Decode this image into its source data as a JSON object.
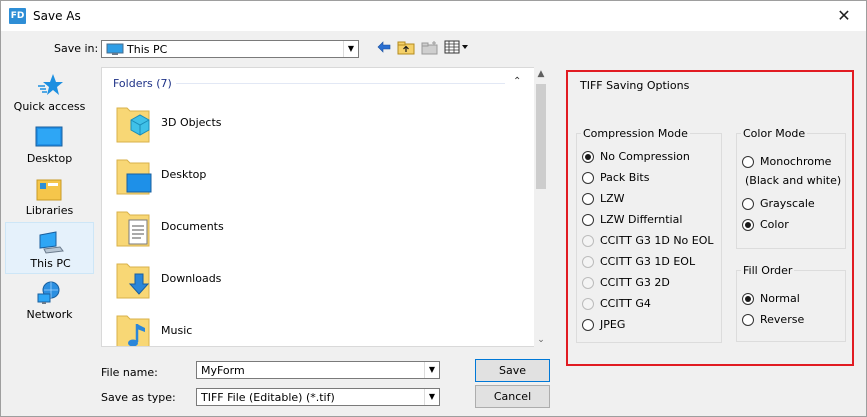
{
  "window": {
    "app_icon": "FD",
    "title": "Save As",
    "close_glyph": "✕"
  },
  "save_in": {
    "label": "Save in:",
    "value": "This PC"
  },
  "toolbar_icons": [
    "back-arrow-icon",
    "up-folder-icon",
    "new-folder-icon",
    "view-menu-icon"
  ],
  "places": [
    {
      "label": "Quick access",
      "icon": "star-icon"
    },
    {
      "label": "Desktop",
      "icon": "desktop-icon"
    },
    {
      "label": "Libraries",
      "icon": "libraries-icon"
    },
    {
      "label": "This PC",
      "icon": "computer-icon",
      "selected": true
    },
    {
      "label": "Network",
      "icon": "network-icon"
    }
  ],
  "file_list": {
    "group_header": "Folders (7)",
    "items": [
      {
        "name": "3D Objects",
        "icon": "3d-objects-folder-icon"
      },
      {
        "name": "Desktop",
        "icon": "desktop-folder-icon"
      },
      {
        "name": "Documents",
        "icon": "documents-folder-icon"
      },
      {
        "name": "Downloads",
        "icon": "downloads-folder-icon"
      },
      {
        "name": "Music",
        "icon": "music-folder-icon"
      }
    ]
  },
  "file_name": {
    "label": "File name:",
    "value": "MyForm"
  },
  "save_as_type": {
    "label": "Save as type:",
    "value": "TIFF File (Editable) (*.tif)"
  },
  "buttons": {
    "save": "Save",
    "cancel": "Cancel"
  },
  "tiff_options": {
    "title": "TIFF Saving Options",
    "compression": {
      "title": "Compression Mode",
      "options": [
        {
          "label": "No Compression",
          "checked": true,
          "enabled": true
        },
        {
          "label": "Pack Bits",
          "checked": false,
          "enabled": true
        },
        {
          "label": "LZW",
          "checked": false,
          "enabled": true
        },
        {
          "label": "LZW Differntial",
          "checked": false,
          "enabled": true
        },
        {
          "label": "CCITT G3 1D No EOL",
          "checked": false,
          "enabled": false
        },
        {
          "label": "CCITT G3 1D EOL",
          "checked": false,
          "enabled": false
        },
        {
          "label": "CCITT G3 2D",
          "checked": false,
          "enabled": false
        },
        {
          "label": "CCITT G4",
          "checked": false,
          "enabled": false
        },
        {
          "label": "JPEG",
          "checked": false,
          "enabled": true
        }
      ]
    },
    "color_mode": {
      "title": "Color Mode",
      "monochrome": "Monochrome",
      "monochrome_sub": "(Black and white)",
      "grayscale": "Grayscale",
      "color": "Color",
      "selected": "Color"
    },
    "fill_order": {
      "title": "Fill Order",
      "normal": "Normal",
      "reverse": "Reverse",
      "selected": "Normal"
    }
  },
  "colors": {
    "accent": "#0078d7",
    "highlight_border": "#e11b22",
    "folder": "#f8d775"
  }
}
